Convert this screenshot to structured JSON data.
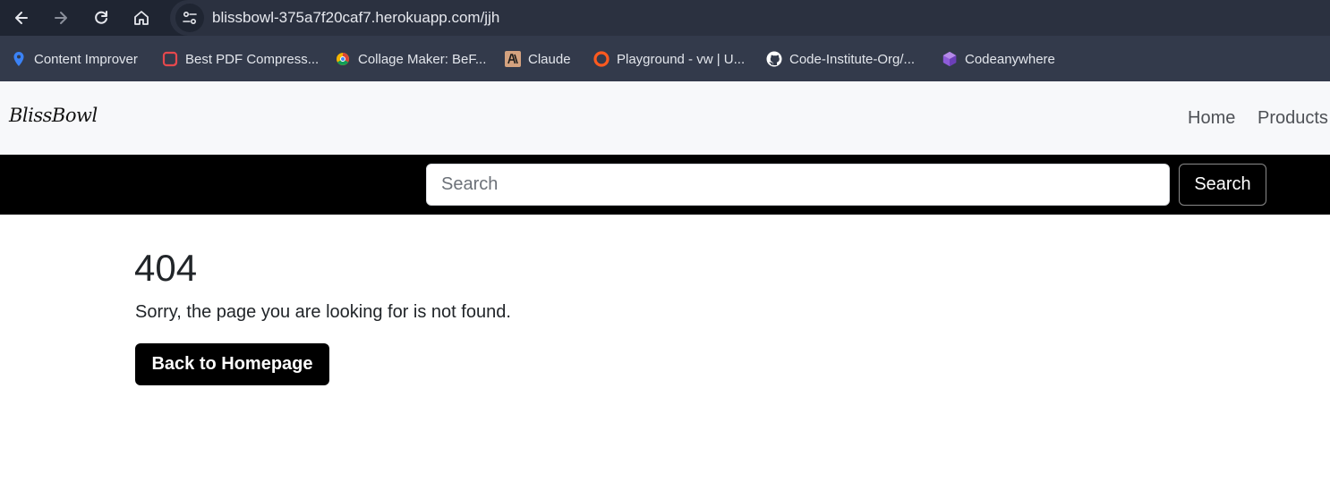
{
  "browser": {
    "url": "blissbowl-375a7f20caf7.herokuapp.com/jjh",
    "bookmarks": [
      {
        "label": "Content Improver",
        "icon": "map-pin-icon"
      },
      {
        "label": "Best PDF Compress...",
        "icon": "pdf-icon"
      },
      {
        "label": "Collage Maker: BeF...",
        "icon": "collage-icon"
      },
      {
        "label": "Claude",
        "icon": "anthropic-icon"
      },
      {
        "label": "Playground - vw | U...",
        "icon": "playground-icon"
      },
      {
        "label": "Code-Institute-Org/...",
        "icon": "github-icon"
      },
      {
        "label": "Codeanywhere",
        "icon": "codeanywhere-icon"
      }
    ]
  },
  "header": {
    "brand": "BlissBowl",
    "nav": [
      {
        "label": "Home"
      },
      {
        "label": "Products"
      }
    ]
  },
  "search": {
    "placeholder": "Search",
    "button_label": "Search"
  },
  "main": {
    "code": "404",
    "message": "Sorry, the page you are looking for is not found.",
    "button_label": "Back to Homepage"
  }
}
